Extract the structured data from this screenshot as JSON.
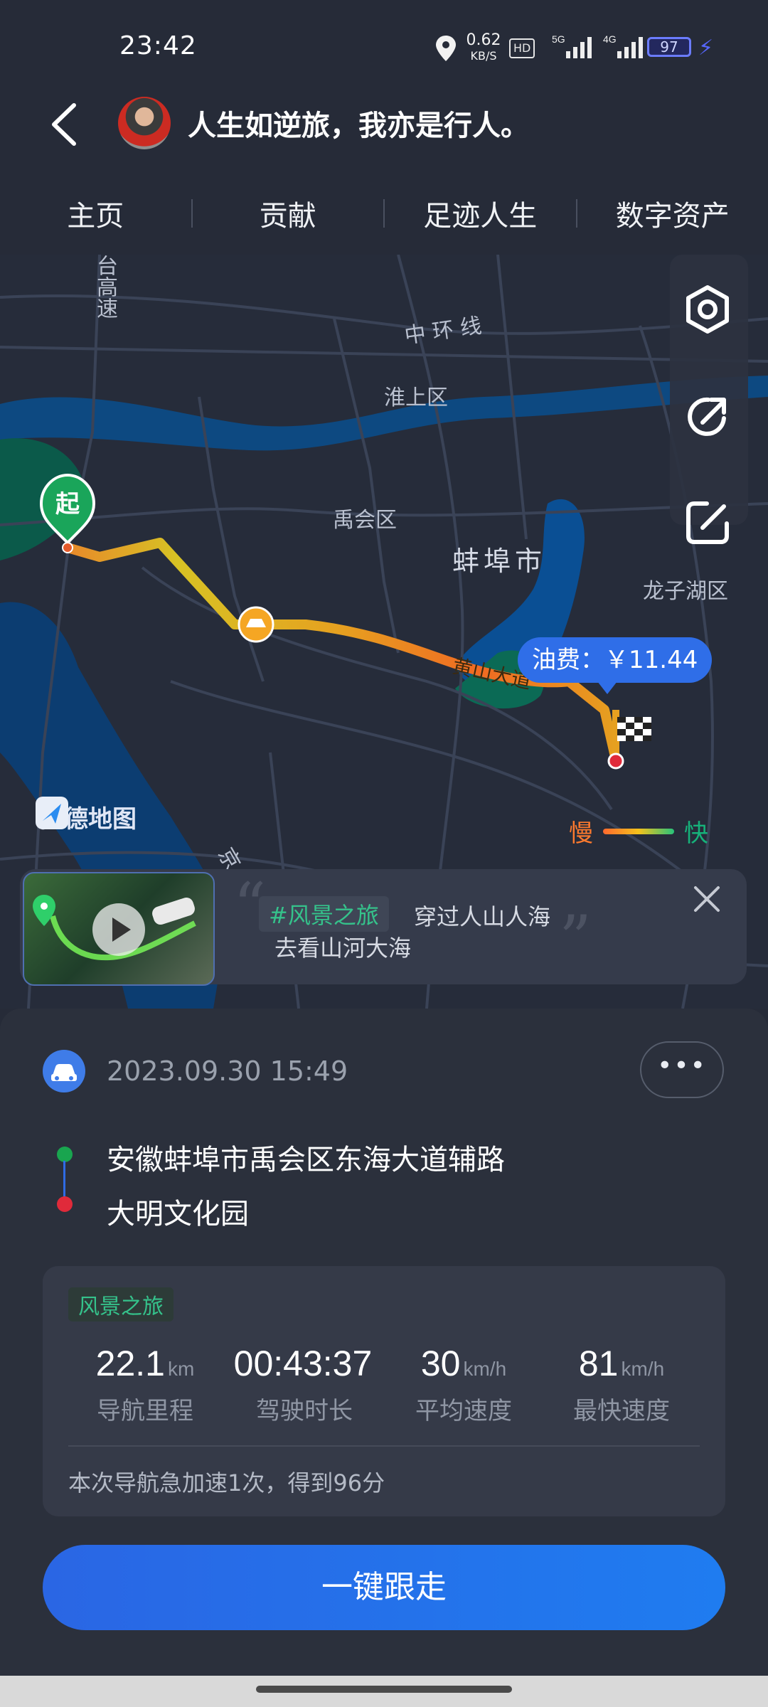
{
  "status_bar": {
    "time": "23:42",
    "net_speed": "0.62",
    "net_unit": "KB/S",
    "hd": "HD",
    "signal_1": "5G",
    "signal_2": "4G",
    "battery": "97"
  },
  "header": {
    "title": "人生如逆旅，我亦是行人。"
  },
  "tabs": [
    {
      "label": "主页"
    },
    {
      "label": "贡献"
    },
    {
      "label": "足迹人生"
    },
    {
      "label": "数字资产"
    }
  ],
  "map": {
    "labels": {
      "road_tai": "台高速",
      "ring": "中 环 线",
      "huaishang": "淮上区",
      "yuhui": "禹会区",
      "city": "蚌埠市",
      "longzihu": "龙子湖区",
      "huangshan": "黄山大道",
      "jing": "京"
    },
    "start_marker": "起",
    "fuel_label": "油费：",
    "fuel_value": "￥11.44",
    "logo_text": "高德地图",
    "legend_slow": "慢",
    "legend_fast": "快"
  },
  "promo": {
    "tag": "#风景之旅",
    "text_1": "穿过人山人海",
    "text_2": "去看山河大海",
    "open_quote": "“",
    "close_quote": "”"
  },
  "trip": {
    "datetime": "2023.09.30 15:49",
    "more": "•••",
    "start_address": "安徽蚌埠市禹会区东海大道辅路",
    "end_address": "大明文化园",
    "tag": "风景之旅",
    "stats": [
      {
        "value": "22.1",
        "unit": "km",
        "label": "导航里程"
      },
      {
        "value": "00:43:37",
        "unit": "",
        "label": "驾驶时长"
      },
      {
        "value": "30",
        "unit": "km/h",
        "label": "平均速度"
      },
      {
        "value": "81",
        "unit": "km/h",
        "label": "最快速度"
      }
    ],
    "note": "本次导航急加速1次，得到96分"
  },
  "actions": {
    "follow": "一键跟走"
  },
  "colors": {
    "accent": "#2f6ee8",
    "green": "#19a54f",
    "red": "#e02a3a",
    "route_slow": "#ff6a2e",
    "route_mid": "#f5c21c"
  }
}
